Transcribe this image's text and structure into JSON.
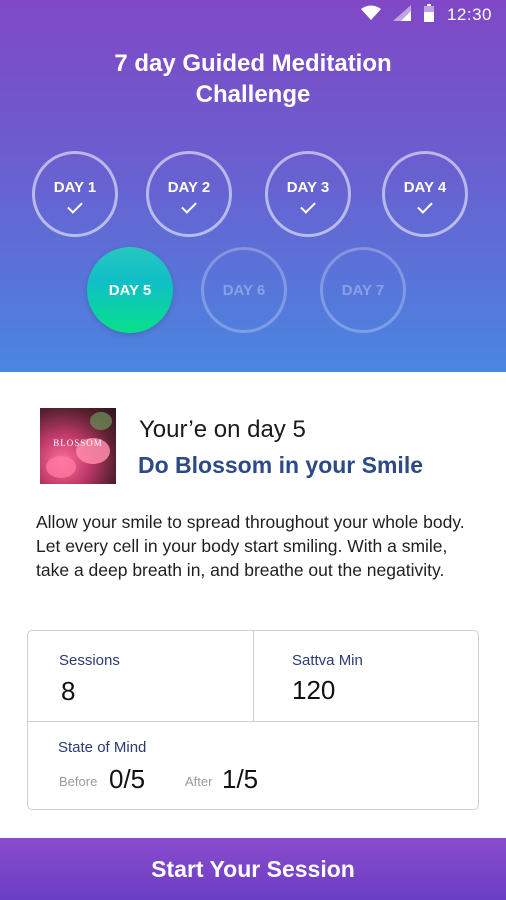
{
  "status_bar": {
    "time": "12:30"
  },
  "header": {
    "title_line1": "7 day Guided Meditation",
    "title_line2": "Challenge"
  },
  "days": [
    {
      "label": "DAY 1",
      "state": "completed"
    },
    {
      "label": "DAY 2",
      "state": "completed"
    },
    {
      "label": "DAY 3",
      "state": "completed"
    },
    {
      "label": "DAY 4",
      "state": "completed"
    },
    {
      "label": "DAY 5",
      "state": "current"
    },
    {
      "label": "DAY 6",
      "state": "locked"
    },
    {
      "label": "DAY 7",
      "state": "locked"
    }
  ],
  "current": {
    "thumbnail_text": "BLOSSOM",
    "day_text": "Your’e on day 5",
    "session_title": "Do Blossom in your Smile",
    "description": "Allow your smile to spread throughout your whole body. Let every cell in your body start smiling. With a smile, take a deep breath in, and breathe out the negativity."
  },
  "stats": {
    "sessions_label": "Sessions",
    "sessions_value": "8",
    "sattva_label": "Sattva Min",
    "sattva_value": "120",
    "state_label": "State of Mind",
    "before_label": "Before",
    "before_value": "0/5",
    "after_label": "After",
    "after_value": "1/5"
  },
  "cta": {
    "label": "Start Your Session"
  },
  "colors": {
    "accent_purple": "#8048c6",
    "accent_blue": "#4a86e0",
    "active_day_teal": "#08e08a",
    "title_blue": "#2c4a86"
  }
}
